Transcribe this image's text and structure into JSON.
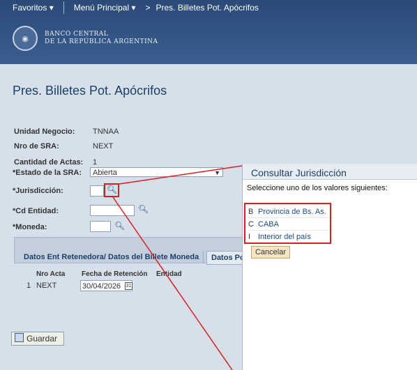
{
  "nav": {
    "favoritos": "Favoritos",
    "menu": "Menú Principal",
    "arrow": ">",
    "crumb": "Pres. Billetes Pot. Apócrifos"
  },
  "bank": {
    "line1": "BANCO CENTRAL",
    "line2": "DE LA REPÚBLICA ARGENTINA"
  },
  "page": {
    "title": "Pres. Billetes Pot. Apócrifos"
  },
  "fields": {
    "unidad_label": "Unidad Negocio:",
    "unidad_value": "TNNAA",
    "nro_label": "Nro de SRA:",
    "nro_value": "NEXT",
    "cant_label": "Cantidad de Actas:",
    "cant_value": "1",
    "estado_label": "*Estado de la SRA:",
    "estado_value": "Abierta",
    "jur_label": "*Jurisdicción:",
    "cd_label": "*Cd Entidad:",
    "moneda_label": "*Moneda:"
  },
  "tabs": {
    "tab1": "Datos Ent Retenedora/ Datos del Billete Moneda",
    "tab2": "Datos Po"
  },
  "grid": {
    "h1": "Nro Acta",
    "h2": "Fecha de Retención",
    "h3": "Entidad",
    "row_num": "1",
    "row_acta": "NEXT",
    "row_fecha": "30/04/2026"
  },
  "save": {
    "label": "Guardar"
  },
  "popup": {
    "title": "Consultar Jurisdicción",
    "instr": "Seleccione uno de los valores siguientes:",
    "items": [
      {
        "code": "B",
        "desc": "Provincia de Bs. As."
      },
      {
        "code": "C",
        "desc": "CABA"
      },
      {
        "code": "I",
        "desc": "Interior del país"
      }
    ],
    "cancel": "Cancelar"
  },
  "colors": {
    "highlight": "#e01c1c",
    "header": "#2a4a78",
    "accent": "#1d3f6b"
  }
}
